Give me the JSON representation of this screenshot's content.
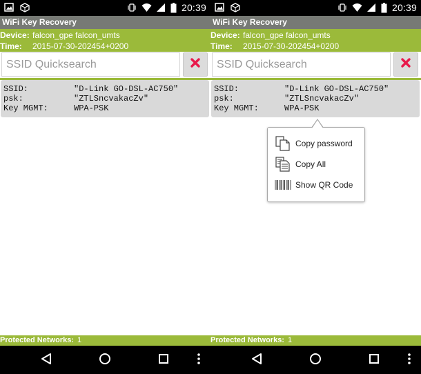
{
  "screens": [
    {
      "statusbar": {
        "time": "20:39"
      },
      "app_title": "WiFi Key Recovery",
      "device": {
        "label": "Device:",
        "value": "falcon_gpe falcon_umts"
      },
      "time": {
        "label": "Time:",
        "value": "2015-07-30-202454+0200"
      },
      "search": {
        "placeholder": "SSID Quicksearch"
      },
      "network": {
        "ssid_label": "SSID:",
        "ssid_value": "\"D-Link GO-DSL-AC750\"",
        "psk_label": "psk:",
        "psk_value": "\"ZTLSncvakacZv\"",
        "mgmt_label": "Key MGMT:",
        "mgmt_value": "WPA-PSK"
      },
      "footer": {
        "label": "Protected Networks:",
        "count": "1"
      }
    },
    {
      "statusbar": {
        "time": "20:39"
      },
      "app_title": "WiFi Key Recovery",
      "device": {
        "label": "Device:",
        "value": "falcon_gpe falcon_umts"
      },
      "time": {
        "label": "Time:",
        "value": "2015-07-30-202454+0200"
      },
      "search": {
        "placeholder": "SSID Quicksearch"
      },
      "network": {
        "ssid_label": "SSID:",
        "ssid_value": "\"D-Link GO-DSL-AC750\"",
        "psk_label": "psk:",
        "psk_value": "\"ZTLSncvakacZv\"",
        "mgmt_label": "Key MGMT:",
        "mgmt_value": "WPA-PSK"
      },
      "context_menu": {
        "items": [
          {
            "label": "Copy password",
            "icon": "copy-icon"
          },
          {
            "label": "Copy All",
            "icon": "copy-all-icon"
          },
          {
            "label": "Show QR Code",
            "icon": "barcode-icon"
          }
        ]
      },
      "footer": {
        "label": "Protected Networks:",
        "count": "1"
      }
    }
  ],
  "colors": {
    "accent_green": "#9bba3a",
    "title_gray": "#777a75",
    "card_gray": "#d9d9d9",
    "clear_red": "#e8184a"
  },
  "status_icons": [
    "image-icon",
    "box-icon",
    "vibrate-icon",
    "wifi-icon",
    "signal-icon",
    "battery-icon"
  ],
  "nav_icons": [
    "back-icon",
    "home-icon",
    "recents-icon",
    "overflow-menu-icon"
  ]
}
